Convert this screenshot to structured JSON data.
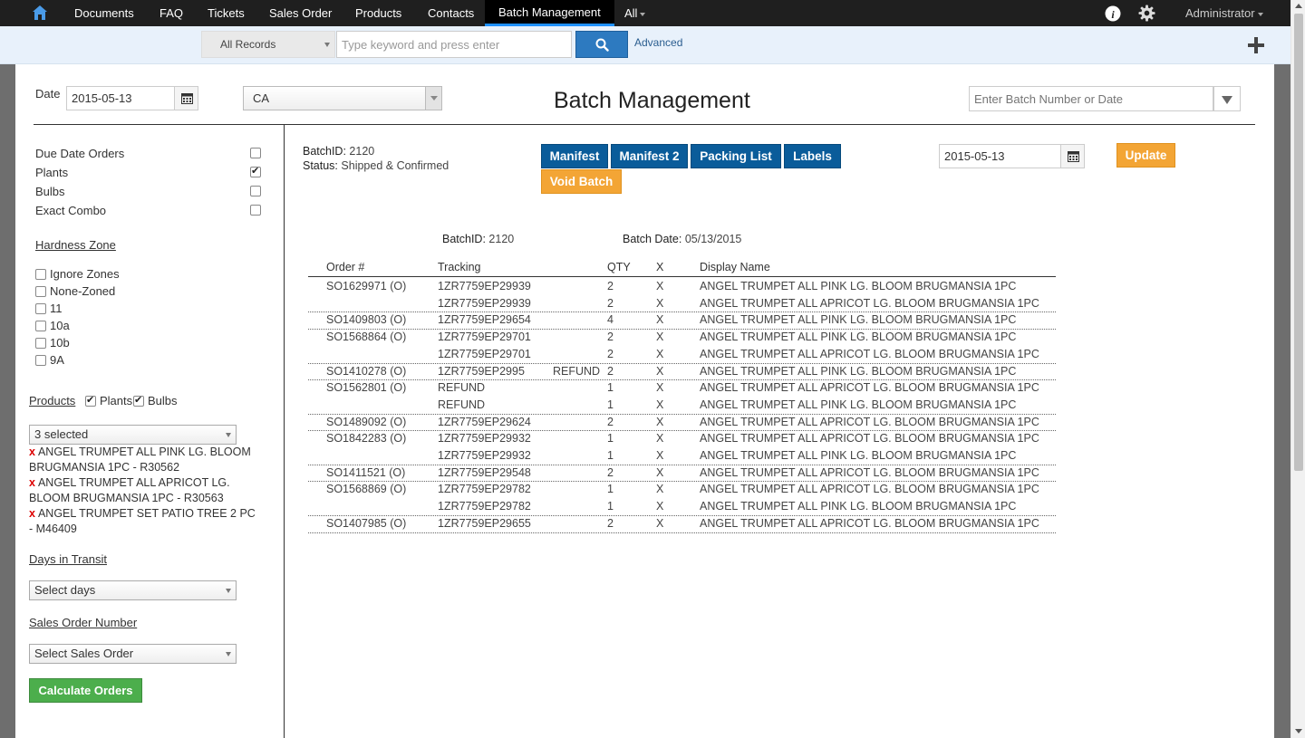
{
  "nav": {
    "items": [
      "Documents",
      "FAQ",
      "Tickets",
      "Sales Order",
      "Products",
      "Contacts",
      "Batch Management",
      "All"
    ],
    "user": "Administrator"
  },
  "search": {
    "records": "All Records",
    "placeholder": "Type keyword and press enter",
    "advanced": "Advanced"
  },
  "header": {
    "date_label": "Date",
    "date_value": "2015-05-13",
    "state": "CA",
    "title": "Batch Management",
    "batch_placeholder": "Enter Batch Number or Date"
  },
  "filters": {
    "checks": [
      {
        "label": "Due Date Orders",
        "checked": false
      },
      {
        "label": "Plants",
        "checked": true
      },
      {
        "label": "Bulbs",
        "checked": false
      },
      {
        "label": "Exact Combo",
        "checked": false
      }
    ],
    "hardness_label": "Hardness Zone",
    "zones": [
      "Ignore Zones",
      "None-Zoned",
      "11",
      "10a",
      "10b",
      "9A"
    ],
    "products_label": "Products",
    "products_plants": "Plants",
    "products_bulbs": "Bulbs",
    "products_selected": "3 selected",
    "selected_products": [
      "ANGEL TRUMPET ALL PINK LG. BLOOM BRUGMANSIA 1PC - R30562",
      "ANGEL TRUMPET ALL APRICOT LG. BLOOM BRUGMANSIA 1PC - R30563",
      "ANGEL TRUMPET SET PATIO TREE 2 PC - M46409"
    ],
    "transit_label": "Days in Transit",
    "transit_select": "Select days",
    "so_label": "Sales Order Number",
    "so_select": "Select Sales Order",
    "calc_button": "Calculate Orders"
  },
  "batch": {
    "id_label": "BatchID:",
    "id": "2120",
    "status_label": "Status:",
    "status": "Shipped & Confirmed",
    "buttons": {
      "manifest": "Manifest",
      "manifest2": "Manifest 2",
      "packing": "Packing List",
      "labels": "Labels",
      "void": "Void Batch",
      "update": "Update"
    },
    "update_date": "2015-05-13",
    "summary_date_label": "Batch Date:",
    "summary_date": "05/13/2015"
  },
  "table": {
    "headers": [
      "Order #",
      "Tracking",
      "QTY",
      "X",
      "Display Name"
    ],
    "rows": [
      {
        "order": "SO1629971 (O)",
        "tracking": "1ZR7759EP29939",
        "note": "",
        "qty": "2",
        "x": "X",
        "name": "ANGEL TRUMPET ALL PINK LG. BLOOM BRUGMANSIA 1PC",
        "first": true
      },
      {
        "order": "",
        "tracking": "1ZR7759EP29939",
        "note": "",
        "qty": "2",
        "x": "X",
        "name": "ANGEL TRUMPET ALL APRICOT LG. BLOOM BRUGMANSIA 1PC",
        "first": false
      },
      {
        "order": "SO1409803 (O)",
        "tracking": "1ZR7759EP29654",
        "note": "",
        "qty": "4",
        "x": "X",
        "name": "ANGEL TRUMPET ALL PINK LG. BLOOM BRUGMANSIA 1PC",
        "first": true
      },
      {
        "order": "SO1568864 (O)",
        "tracking": "1ZR7759EP29701",
        "note": "",
        "qty": "2",
        "x": "X",
        "name": "ANGEL TRUMPET ALL PINK LG. BLOOM BRUGMANSIA 1PC",
        "first": true
      },
      {
        "order": "",
        "tracking": "1ZR7759EP29701",
        "note": "",
        "qty": "2",
        "x": "X",
        "name": "ANGEL TRUMPET ALL APRICOT LG. BLOOM BRUGMANSIA 1PC",
        "first": false
      },
      {
        "order": "SO1410278 (O)",
        "tracking": "1ZR7759EP2995",
        "note": "REFUND",
        "qty": "2",
        "x": "X",
        "name": "ANGEL TRUMPET ALL PINK LG. BLOOM BRUGMANSIA 1PC",
        "first": true
      },
      {
        "order": "SO1562801 (O)",
        "tracking": "REFUND",
        "note": "",
        "qty": "1",
        "x": "X",
        "name": "ANGEL TRUMPET ALL APRICOT LG. BLOOM BRUGMANSIA 1PC",
        "first": true
      },
      {
        "order": "",
        "tracking": "REFUND",
        "note": "",
        "qty": "1",
        "x": "X",
        "name": "ANGEL TRUMPET ALL PINK LG. BLOOM BRUGMANSIA 1PC",
        "first": false
      },
      {
        "order": "SO1489092 (O)",
        "tracking": "1ZR7759EP29624",
        "note": "",
        "qty": "2",
        "x": "X",
        "name": "ANGEL TRUMPET ALL APRICOT LG. BLOOM BRUGMANSIA 1PC",
        "first": true
      },
      {
        "order": "SO1842283 (O)",
        "tracking": "1ZR7759EP29932",
        "note": "",
        "qty": "1",
        "x": "X",
        "name": "ANGEL TRUMPET ALL APRICOT LG. BLOOM BRUGMANSIA 1PC",
        "first": true
      },
      {
        "order": "",
        "tracking": "1ZR7759EP29932",
        "note": "",
        "qty": "1",
        "x": "X",
        "name": "ANGEL TRUMPET ALL PINK LG. BLOOM BRUGMANSIA 1PC",
        "first": false
      },
      {
        "order": "SO1411521 (O)",
        "tracking": "1ZR7759EP29548",
        "note": "",
        "qty": "2",
        "x": "X",
        "name": "ANGEL TRUMPET ALL APRICOT LG. BLOOM BRUGMANSIA 1PC",
        "first": true
      },
      {
        "order": "SO1568869 (O)",
        "tracking": "1ZR7759EP29782",
        "note": "",
        "qty": "1",
        "x": "X",
        "name": "ANGEL TRUMPET ALL APRICOT LG. BLOOM BRUGMANSIA 1PC",
        "first": true
      },
      {
        "order": "",
        "tracking": "1ZR7759EP29782",
        "note": "",
        "qty": "1",
        "x": "X",
        "name": "ANGEL TRUMPET ALL PINK LG. BLOOM BRUGMANSIA 1PC",
        "first": false
      },
      {
        "order": "SO1407985 (O)",
        "tracking": "1ZR7759EP29655",
        "note": "",
        "qty": "2",
        "x": "X",
        "name": "ANGEL TRUMPET ALL APRICOT LG. BLOOM BRUGMANSIA 1PC",
        "first": true
      }
    ]
  }
}
